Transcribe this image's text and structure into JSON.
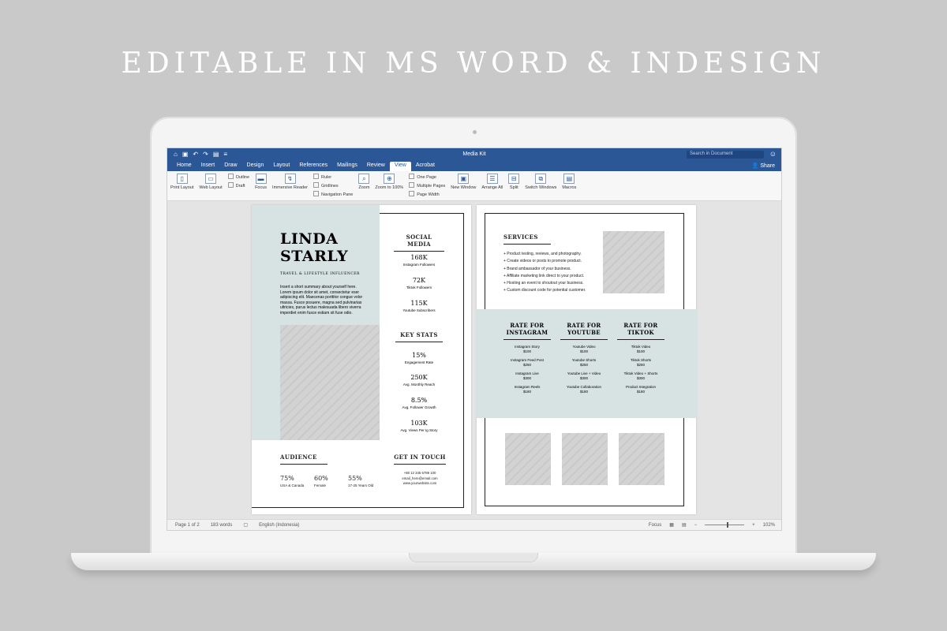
{
  "headline": "EDITABLE IN MS WORD & INDESIGN",
  "word": {
    "doc_title": "Media Kit",
    "search_placeholder": "Search in Document",
    "share_label": "Share",
    "tabs": [
      "Home",
      "Insert",
      "Draw",
      "Design",
      "Layout",
      "References",
      "Mailings",
      "Review",
      "View",
      "Acrobat"
    ],
    "active_tab": "View",
    "ribbon": {
      "print_layout": "Print Layout",
      "web_layout": "Web Layout",
      "outline": "Outline",
      "draft": "Draft",
      "focus": "Focus",
      "immersive_reader": "Immersive Reader",
      "ruler": "Ruler",
      "gridlines": "Gridlines",
      "navigation_pane": "Navigation Pane",
      "zoom": "Zoom",
      "zoom_100": "Zoom to 100%",
      "one_page": "One Page",
      "multiple_pages": "Multiple Pages",
      "page_width": "Page Width",
      "new_window": "New Window",
      "arrange_all": "Arrange All",
      "split": "Split",
      "switch_windows": "Switch Windows",
      "macros": "Macros"
    },
    "status": {
      "page": "Page 1 of 2",
      "words": "183 words",
      "language": "English (Indonesia)",
      "focus": "Focus",
      "zoom": "102%"
    }
  },
  "page1": {
    "name_line1": "LINDA",
    "name_line2": "STARLY",
    "role": "TRAVEL & LIFESTYLE INFLUENCER",
    "bio": "Insert a short summary about yourself here. Lorem ipsum dolor sit amet, consectetur eser adipiscing elit. Maecenas porttitor congue volor massa. Fusce posuere, magna sed pulvinarias ultricies, purus lectus malesuada libero viverra imperdiet enim fusce estiam sit fuse odio.",
    "social_heading": "SOCIAL MEDIA",
    "social": [
      {
        "value": "168K",
        "label": "Instagram Followers"
      },
      {
        "value": "72K",
        "label": "Tiktok Followers"
      },
      {
        "value": "115K",
        "label": "Youtube Subscribers"
      }
    ],
    "stats_heading": "KEY STATS",
    "stats": [
      {
        "value": "15%",
        "label": "Engagement Rate"
      },
      {
        "value": "250K",
        "label": "Avg. Monthly Reach"
      },
      {
        "value": "8.5%",
        "label": "Avg. Follower Growth"
      },
      {
        "value": "103K",
        "label": "Avg. Views Per Ig Story"
      }
    ],
    "audience_heading": "AUDIENCE",
    "audience": [
      {
        "value": "75%",
        "label": "USA & Canada"
      },
      {
        "value": "60%",
        "label": "Female"
      },
      {
        "value": "55%",
        "label": "17-25 Years Old"
      }
    ],
    "contact_heading": "GET IN TOUCH",
    "contact": [
      "+88 12 345 6789 100",
      "email_here@email.com",
      "www.yourwebsite.com"
    ]
  },
  "page2": {
    "services_heading": "SERVICES",
    "services": [
      "+ Product testing, reviews, and photography.",
      "+ Create videos or posts to promote product.",
      "+ Brand ambassador of your business.",
      "+ Affiliate marketing link direct to your product.",
      "+ Hosting an event to shoutout your business.",
      "+ Custom discount code for potential customer."
    ],
    "rates": [
      {
        "title1": "RATE FOR",
        "title2": "INSTAGRAM",
        "items": [
          {
            "name": "Instagram Story",
            "price": "$100"
          },
          {
            "name": "Instagram Feed Post",
            "price": "$250"
          },
          {
            "name": "Instagram Live",
            "price": "$300"
          },
          {
            "name": "Instagram Reels",
            "price": "$180"
          }
        ]
      },
      {
        "title1": "RATE FOR",
        "title2": "YOUTUBE",
        "items": [
          {
            "name": "Youtube Video",
            "price": "$100"
          },
          {
            "name": "Youtube Shorts",
            "price": "$250"
          },
          {
            "name": "Youtube Live + Video",
            "price": "$300"
          },
          {
            "name": "Youtube Collaboration",
            "price": "$180"
          }
        ]
      },
      {
        "title1": "RATE FOR",
        "title2": "TIKTOK",
        "items": [
          {
            "name": "Tiktok Video",
            "price": "$100"
          },
          {
            "name": "Tiktok Shorts",
            "price": "$250"
          },
          {
            "name": "Tiktok Video + Shorts",
            "price": "$300"
          },
          {
            "name": "Product Integration",
            "price": "$180"
          }
        ]
      }
    ]
  }
}
